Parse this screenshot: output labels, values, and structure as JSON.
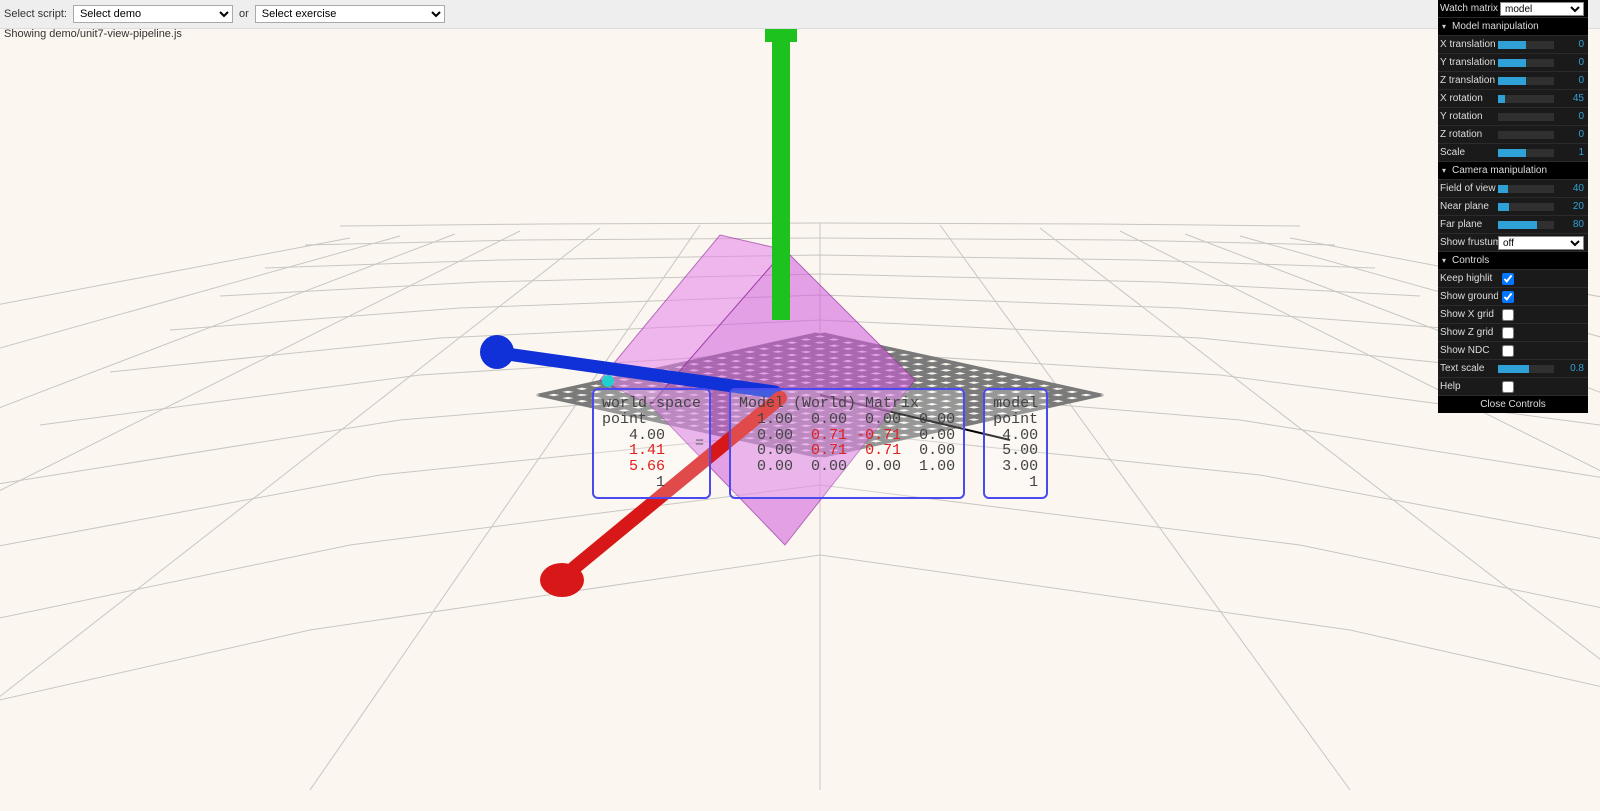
{
  "topbar": {
    "select_script_label": "Select script:",
    "demo_placeholder": "Select demo",
    "or_label": "or",
    "exercise_placeholder": "Select exercise",
    "showing_label": "Showing demo/unit7-view-pipeline.js"
  },
  "overlay": {
    "world_space": {
      "title1": "world-space",
      "title2": "point",
      "rows": [
        "4.00",
        "1.41",
        "5.66",
        "1"
      ],
      "red_rows": [
        1,
        2
      ]
    },
    "model_matrix": {
      "title": "Model (World) Matrix",
      "rows": [
        [
          " 1.00",
          " 0.00",
          " 0.00",
          " 0.00"
        ],
        [
          " 0.00",
          " 0.71",
          "-0.71",
          " 0.00"
        ],
        [
          " 0.00",
          " 0.71",
          " 0.71",
          " 0.00"
        ],
        [
          " 0.00",
          " 0.00",
          " 0.00",
          " 1.00"
        ]
      ],
      "red_cells": [
        [
          1,
          1
        ],
        [
          1,
          2
        ],
        [
          2,
          1
        ],
        [
          2,
          2
        ]
      ]
    },
    "model_point": {
      "title1": "model",
      "title2": "point",
      "rows": [
        "4.00",
        "5.00",
        "3.00",
        "1"
      ]
    },
    "eq": "="
  },
  "gui": {
    "watch_matrix": {
      "label": "Watch matrix",
      "value": "model"
    },
    "folders": [
      {
        "title": "Model manipulation",
        "items": [
          {
            "type": "slider",
            "label": "X translation",
            "value": 0,
            "pct": 50
          },
          {
            "type": "slider",
            "label": "Y translation",
            "value": 0,
            "pct": 50
          },
          {
            "type": "slider",
            "label": "Z translation",
            "value": 0,
            "pct": 50
          },
          {
            "type": "slider",
            "label": "X rotation",
            "value": 45,
            "pct": 12
          },
          {
            "type": "slider",
            "label": "Y rotation",
            "value": 0,
            "pct": 0
          },
          {
            "type": "slider",
            "label": "Z rotation",
            "value": 0,
            "pct": 0
          },
          {
            "type": "slider",
            "label": "Scale",
            "value": 1,
            "pct": 50
          }
        ]
      },
      {
        "title": "Camera manipulation",
        "items": [
          {
            "type": "slider",
            "label": "Field of view",
            "value": 40,
            "pct": 18
          },
          {
            "type": "slider",
            "label": "Near plane",
            "value": 20,
            "pct": 20
          },
          {
            "type": "slider",
            "label": "Far plane",
            "value": 80,
            "pct": 70
          }
        ]
      }
    ],
    "show_frustum": {
      "label": "Show frustum",
      "value": "off"
    },
    "controls_folder": {
      "title": "Controls",
      "items": [
        {
          "type": "check",
          "label": "Keep highlit",
          "checked": true
        },
        {
          "type": "check",
          "label": "Show ground",
          "checked": true
        },
        {
          "type": "check",
          "label": "Show X grid",
          "checked": false
        },
        {
          "type": "check",
          "label": "Show Z grid",
          "checked": false
        },
        {
          "type": "check",
          "label": "Show NDC",
          "checked": false
        },
        {
          "type": "slider",
          "label": "Text scale",
          "value": 0.8,
          "pct": 55
        },
        {
          "type": "check",
          "label": "Help",
          "checked": false
        }
      ]
    },
    "close_label": "Close Controls"
  }
}
